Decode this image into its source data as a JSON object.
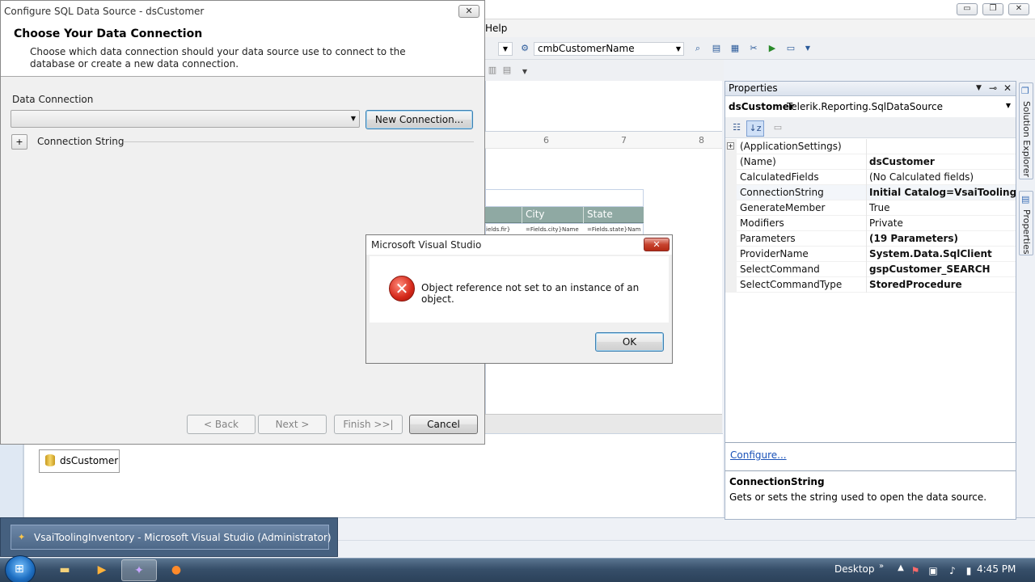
{
  "vs": {
    "menu_help": "Help",
    "toolbar_combo": "cmbCustomerName",
    "ruler_ticks": [
      "6",
      "7",
      "8"
    ],
    "report_columns": [
      "City",
      "State"
    ],
    "report_row_cells": [
      "ields.fir}",
      "=Fields.city}Name",
      "=Fields.state}Nam"
    ],
    "tray_component": "dsCustomer",
    "window_controls": {
      "minimize": "▭",
      "restore": "❐",
      "close": "✕"
    }
  },
  "properties": {
    "title": "Properties",
    "object_name": "dsCustomer",
    "object_type": "Telerik.Reporting.SqlDataSource",
    "rows": [
      {
        "name": "(ApplicationSettings)",
        "value": "",
        "bold": false,
        "expandable": true
      },
      {
        "name": "(Name)",
        "value": "dsCustomer",
        "bold": true,
        "expandable": false
      },
      {
        "name": "CalculatedFields",
        "value": "(No Calculated fields)",
        "bold": false,
        "expandable": false
      },
      {
        "name": "ConnectionString",
        "value": "Initial Catalog=VsaiToolingInventory",
        "bold": true,
        "expandable": false,
        "selected": true
      },
      {
        "name": "GenerateMember",
        "value": "True",
        "bold": false,
        "expandable": false
      },
      {
        "name": "Modifiers",
        "value": "Private",
        "bold": false,
        "expandable": false
      },
      {
        "name": "Parameters",
        "value": "(19 Parameters)",
        "bold": true,
        "expandable": false
      },
      {
        "name": "ProviderName",
        "value": "System.Data.SqlClient",
        "bold": true,
        "expandable": false
      },
      {
        "name": "SelectCommand",
        "value": "gspCustomer_SEARCH",
        "bold": true,
        "expandable": false
      },
      {
        "name": "SelectCommandType",
        "value": "StoredProcedure",
        "bold": true,
        "expandable": false
      }
    ],
    "configure_link": "Configure...",
    "desc_title": "ConnectionString",
    "desc_text": "Gets or sets the string used to open the data source."
  },
  "side_tabs": {
    "solution_explorer": "Solution Explorer",
    "properties": "Properties"
  },
  "configure_dialog": {
    "title": "Configure SQL Data Source - dsCustomer",
    "heading": "Choose Your Data Connection",
    "description": "Choose which data connection should your data source use to connect to the database or create a new data connection.",
    "data_connection_label": "Data Connection",
    "data_connection_value": "",
    "new_connection_button": "New Connection...",
    "connection_string_label": "Connection String",
    "expander": "+",
    "back_button": "< Back",
    "next_button": "Next >",
    "finish_button": "Finish >>|",
    "cancel_button": "Cancel"
  },
  "message_box": {
    "title": "Microsoft Visual Studio",
    "message": "Object reference not set to an instance of an object.",
    "ok_button": "OK",
    "icon": "error-icon"
  },
  "taskbar": {
    "thumbnail_title": "VsaiToolingInventory - Microsoft Visual Studio (Administrator)",
    "desktop_label": "Desktop",
    "clock": "4:45 PM"
  }
}
